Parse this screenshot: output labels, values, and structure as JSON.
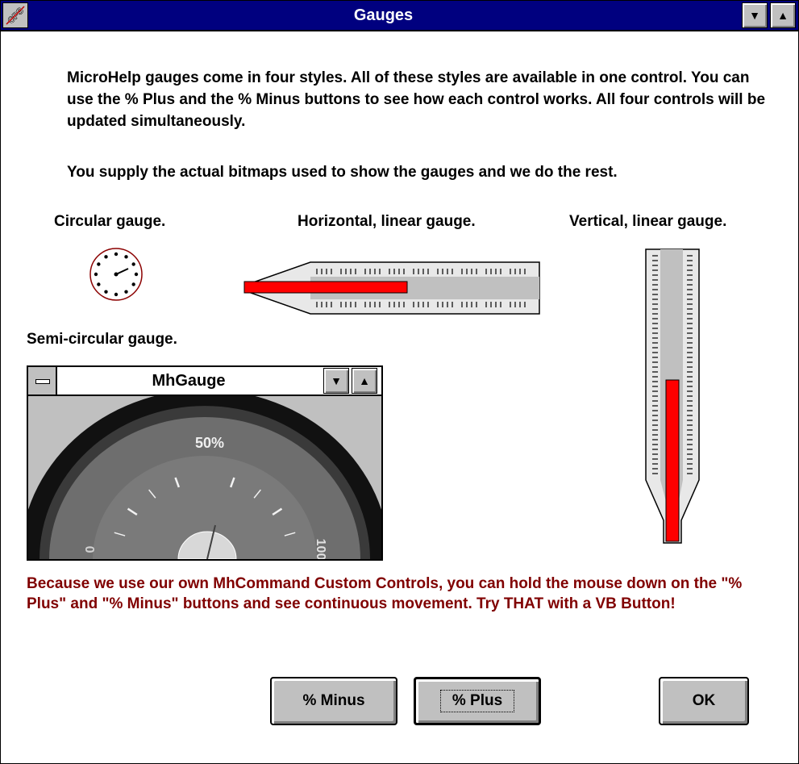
{
  "window": {
    "title": "Gauges",
    "sysmenu_icon": "cps-logo-icon"
  },
  "intro_text": "MicroHelp gauges come in four styles. All of these styles are available in one control. You can use the % Plus and the % Minus  buttons to see how each control works. All four controls will be updated simultaneously.",
  "supply_text": "You supply the actual bitmaps used to show the gauges and we do the rest.",
  "labels": {
    "circular": "Circular gauge.",
    "horizontal": "Horizontal, linear gauge.",
    "vertical": "Vertical, linear gauge.",
    "semicircular": "Semi-circular gauge."
  },
  "child_window": {
    "title": "MhGauge",
    "dial_labels": {
      "left": "0",
      "top": "50%",
      "right": "100"
    }
  },
  "gauge_value_percent": 50,
  "note_text": "Because we use our own MhCommand Custom Controls, you can hold the mouse down on the \"% Plus\" and \"% Minus\" buttons and see continuous movement. Try THAT with a VB Button!",
  "buttons": {
    "minus": "% Minus",
    "plus": "% Plus",
    "ok": "OK"
  },
  "colors": {
    "titlebar": "#00007f",
    "gauge_fill": "#ff0000",
    "note_text": "#800000",
    "face": "#c0c0c0"
  }
}
